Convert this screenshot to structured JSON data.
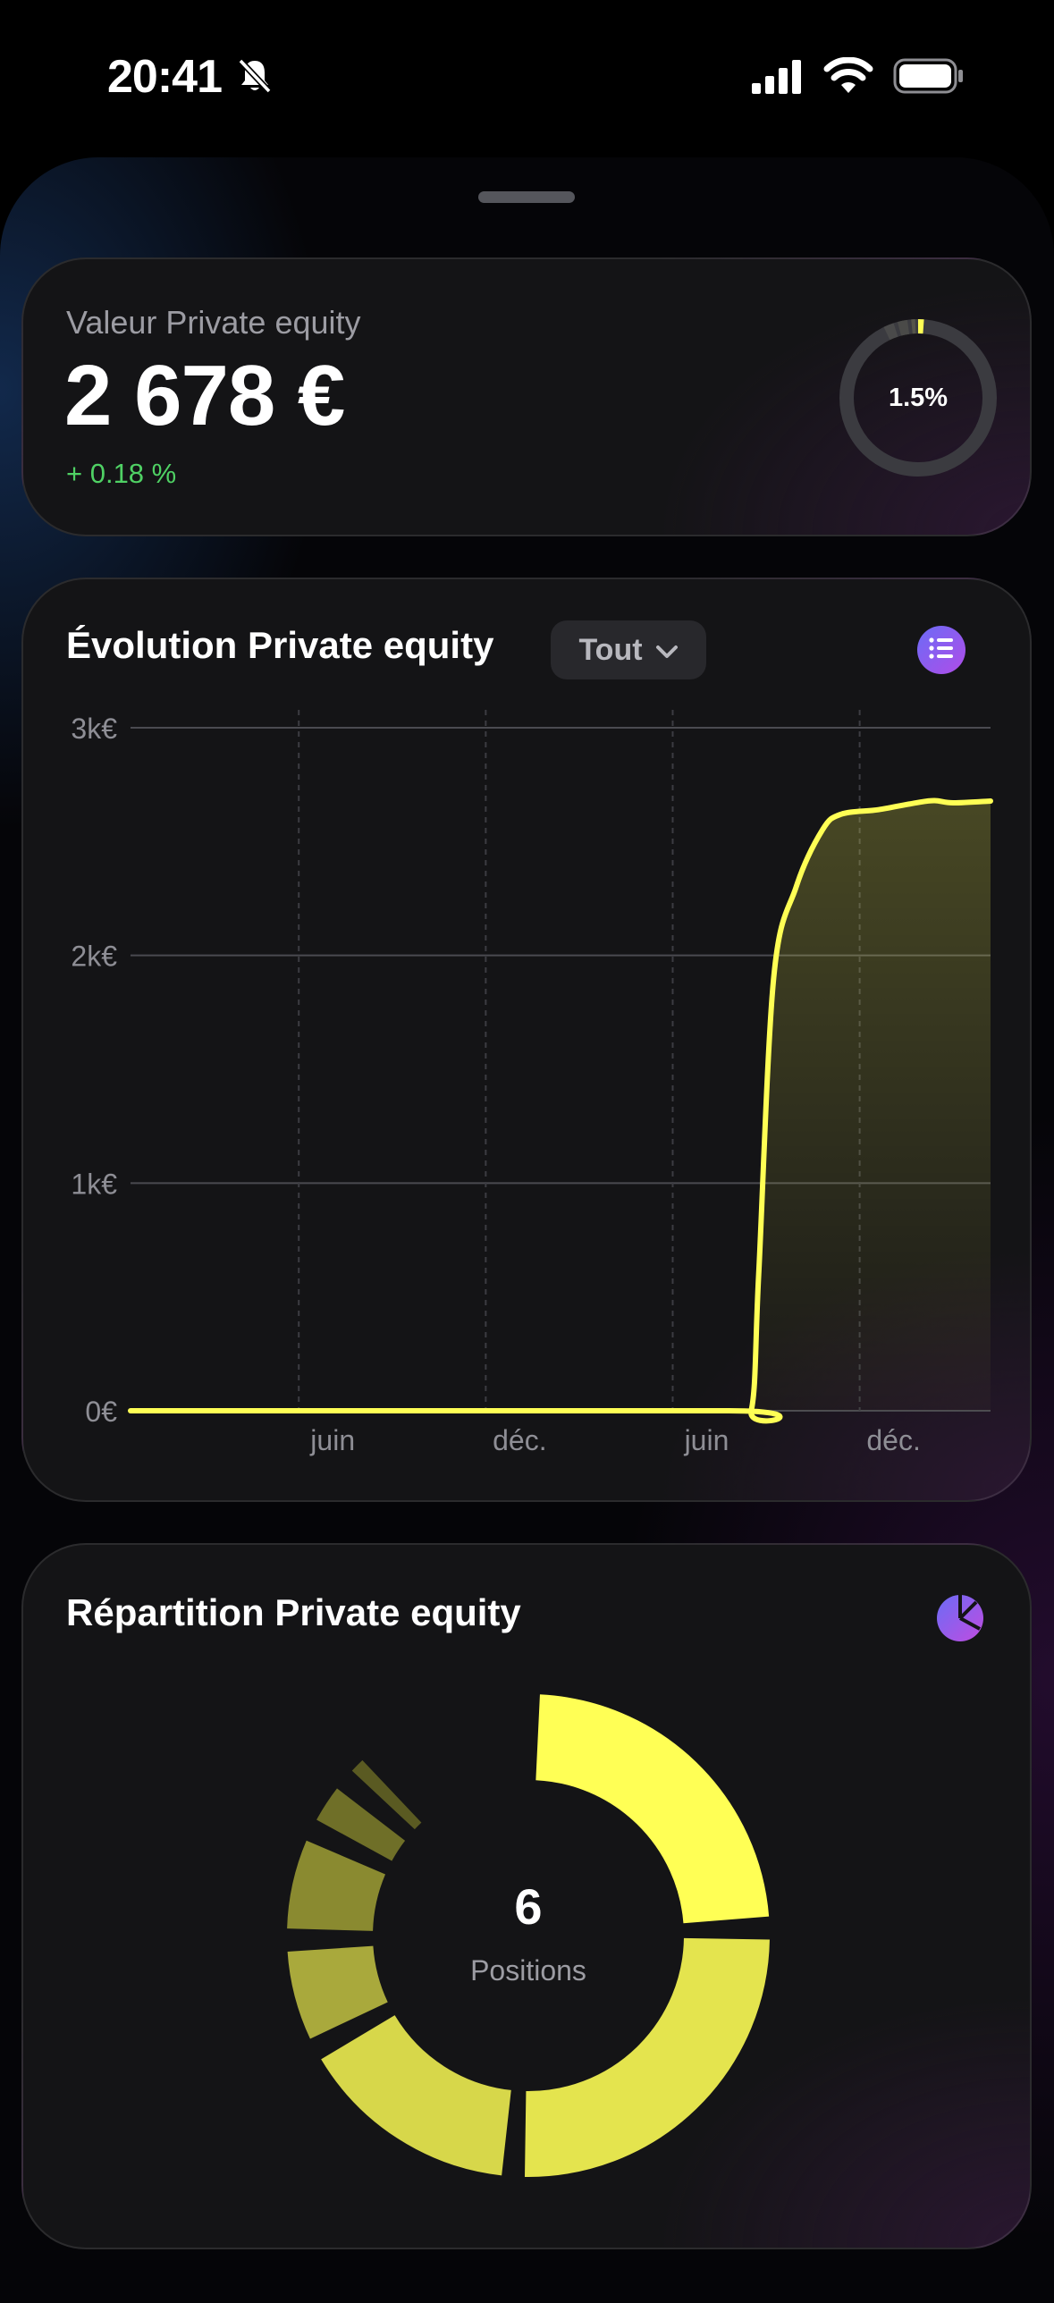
{
  "status_bar": {
    "time": "20:41",
    "icons": [
      "bell-slash-icon",
      "cellular-signal-icon",
      "wifi-icon",
      "battery-icon"
    ]
  },
  "value_card": {
    "label": "Valeur Private equity",
    "amount": "2 678 €",
    "change": "+ 0.18 %",
    "share_text": "1.5%",
    "share_fraction": 0.015,
    "colors": {
      "positive": "#4fd164",
      "accent": "#ffff55"
    }
  },
  "evolution_card": {
    "title": "Évolution Private equity",
    "period_label": "Tout",
    "icons": [
      "chevron-down-icon",
      "list-icon"
    ]
  },
  "chart_data": {
    "type": "area",
    "title": "Évolution Private equity",
    "y_ticks": [
      "3k€",
      "2k€",
      "1k€",
      "0€"
    ],
    "y_tick_values": [
      3000,
      2000,
      1000,
      0
    ],
    "ylim": [
      0,
      3000
    ],
    "x_ticks": [
      "juin",
      "déc.",
      "juin",
      "déc."
    ],
    "xlim": [
      0,
      23
    ],
    "x_tick_positions": [
      4.5,
      9.5,
      14.5,
      19.5
    ],
    "grid": true,
    "series": [
      {
        "color": "#ffff55",
        "points": [
          [
            0,
            0
          ],
          [
            16,
            0
          ],
          [
            16.6,
            0
          ],
          [
            16.8,
            600
          ],
          [
            17.2,
            1900
          ],
          [
            17.8,
            2300
          ],
          [
            18.5,
            2550
          ],
          [
            19,
            2620
          ],
          [
            20,
            2640
          ],
          [
            21,
            2670
          ],
          [
            21.5,
            2680
          ],
          [
            22,
            2670
          ],
          [
            23,
            2678
          ]
        ]
      }
    ]
  },
  "distribution_card": {
    "title": "Répartition Private equity",
    "center_value": "6",
    "center_label": "Positions",
    "icons": [
      "pie-chart-icon"
    ],
    "segments": [
      {
        "fraction": 0.245,
        "color": "#ffff55"
      },
      {
        "fraction": 0.265,
        "color": "#e4e44e"
      },
      {
        "fraction": 0.162,
        "color": "#d7d74a"
      },
      {
        "fraction": 0.075,
        "color": "#a9a93c"
      },
      {
        "fraction": 0.075,
        "color": "#8a8a30"
      },
      {
        "fraction": 0.04,
        "color": "#6f6f28"
      },
      {
        "fraction": 0.025,
        "color": "#5a5a22"
      }
    ]
  }
}
